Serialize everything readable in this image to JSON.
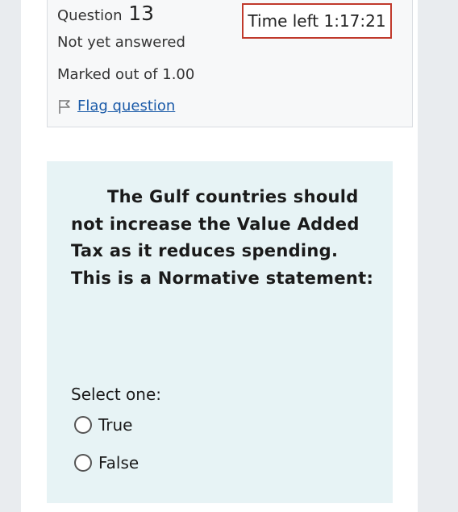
{
  "question_info": {
    "question_word": "Question",
    "question_number": "13",
    "state": "Not yet answered",
    "grade": "Marked out of 1.00",
    "flag_label": "Flag question"
  },
  "timer": {
    "text": "Time left 1:17:21"
  },
  "question": {
    "text": "The Gulf countries should not increase the Value Added Tax as it reduces spending. This is a Normative statement:",
    "prompt": "Select one:",
    "options": [
      {
        "label": "True",
        "selected": false
      },
      {
        "label": "False",
        "selected": false
      }
    ]
  },
  "colors": {
    "timer_border": "#c0392b",
    "link": "#1a5aa8",
    "question_bg": "#e7f3f5",
    "info_bg": "#f7f8f9"
  }
}
